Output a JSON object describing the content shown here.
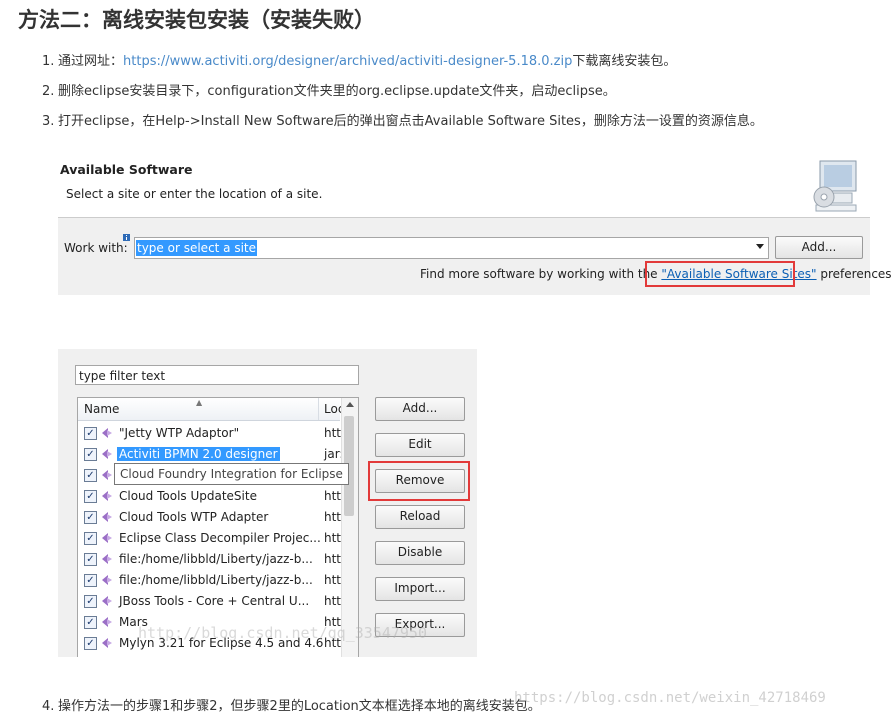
{
  "heading": "方法二：离线安装包安装（安装失败）",
  "steps": [
    {
      "num": "1.",
      "before": "通过网址：",
      "link": "https://www.activiti.org/designer/archived/activiti-designer-5.18.0.zip",
      "after": "下载离线安装包。"
    },
    {
      "num": "2.",
      "text": "删除eclipse安装目录下，configuration文件夹里的org.eclipse.update文件夹，启动eclipse。"
    },
    {
      "num": "3.",
      "text": "打开eclipse，在Help->Install New Software后的弹出窗点击Available Software Sites，删除方法一设置的资源信息。"
    },
    {
      "num": "4.",
      "text": "操作方法一的步骤1和步骤2，但步骤2里的Location文本框选择本地的离线安装包。"
    }
  ],
  "available_software": {
    "title": "Available Software",
    "subtitle": "Select a site or enter the location of a site.",
    "work_with_label": "Work with:",
    "combo_value": "type or select a site",
    "add_button": "Add...",
    "find_more_prefix": "Find more software by working with the ",
    "find_more_link": "\"Available Software Sites\"",
    "find_more_suffix": " preferences."
  },
  "sites_dialog": {
    "filter_placeholder": "type filter text",
    "col_name": "Name",
    "col_location": "Loc",
    "tooltip": "Cloud Foundry Integration for Eclipse",
    "rows": [
      {
        "name": "\"Jetty WTP Adaptor\"",
        "loc": "http",
        "checked": true
      },
      {
        "name": "Activiti BPMN 2.0 designer",
        "loc": "jar:",
        "checked": true,
        "selected": true
      },
      {
        "name": "",
        "loc": "",
        "checked": true
      },
      {
        "name": "Cloud Tools UpdateSite",
        "loc": "http",
        "checked": true
      },
      {
        "name": "Cloud Tools WTP Adapter",
        "loc": "http",
        "checked": true
      },
      {
        "name": "Eclipse Class Decompiler Projec...",
        "loc": "http",
        "checked": true
      },
      {
        "name": "file:/home/libbld/Liberty/jazz-b...",
        "loc": "http",
        "checked": true
      },
      {
        "name": "file:/home/libbld/Liberty/jazz-b...",
        "loc": "http",
        "checked": true
      },
      {
        "name": "JBoss Tools - Core + Central U...",
        "loc": "http",
        "checked": true
      },
      {
        "name": "Mars",
        "loc": "http",
        "checked": true
      },
      {
        "name": "Mylyn 3.21 for Eclipse 4.5 and 4.6",
        "loc": "http",
        "checked": true
      }
    ],
    "buttons": [
      "Add...",
      "Edit",
      "Remove",
      "Reload",
      "Disable",
      "Import...",
      "Export..."
    ]
  },
  "watermark": "https://blog.csdn.net/weixin_42718469",
  "watermark_faint": "http://blog.csdn.net/qq_33547950",
  "colors": {
    "link": "#4a8ac9",
    "highlight": "#3399ff",
    "red_frame": "#e23a3a"
  }
}
